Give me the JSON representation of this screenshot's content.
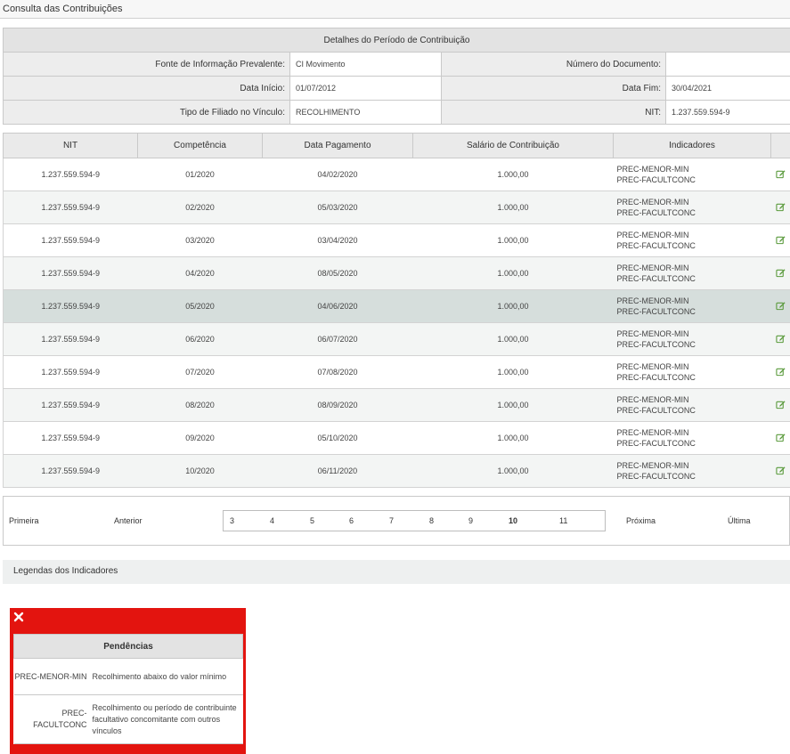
{
  "page": {
    "title": "Consulta das Contribuições"
  },
  "details": {
    "header": "Detalhes do Período de Contribuição",
    "fonte_label": "Fonte de Informação Prevalente:",
    "fonte_value": "CI Movimento",
    "numero_label": "Número do Documento:",
    "numero_value": "",
    "inicio_label": "Data Início:",
    "inicio_value": "01/07/2012",
    "fim_label": "Data Fim:",
    "fim_value": "30/04/2021",
    "tipo_label": "Tipo de Filiado no Vínculo:",
    "tipo_value": "RECOLHIMENTO",
    "nit_label": "NIT:",
    "nit_value": "1.237.559.594-9"
  },
  "contributions": {
    "columns": [
      "NIT",
      "Competência",
      "Data Pagamento",
      "Salário de Contribuição",
      "Indicadores",
      ""
    ],
    "rows": [
      {
        "nit": "1.237.559.594-9",
        "competencia": "01/2020",
        "data_pagamento": "04/02/2020",
        "salario": "1.000,00",
        "ind1": "PREC-MENOR-MIN",
        "ind2": "PREC-FACULTCONC"
      },
      {
        "nit": "1.237.559.594-9",
        "competencia": "02/2020",
        "data_pagamento": "05/03/2020",
        "salario": "1.000,00",
        "ind1": "PREC-MENOR-MIN",
        "ind2": "PREC-FACULTCONC"
      },
      {
        "nit": "1.237.559.594-9",
        "competencia": "03/2020",
        "data_pagamento": "03/04/2020",
        "salario": "1.000,00",
        "ind1": "PREC-MENOR-MIN",
        "ind2": "PREC-FACULTCONC"
      },
      {
        "nit": "1.237.559.594-9",
        "competencia": "04/2020",
        "data_pagamento": "08/05/2020",
        "salario": "1.000,00",
        "ind1": "PREC-MENOR-MIN",
        "ind2": "PREC-FACULTCONC"
      },
      {
        "nit": "1.237.559.594-9",
        "competencia": "05/2020",
        "data_pagamento": "04/06/2020",
        "salario": "1.000,00",
        "ind1": "PREC-MENOR-MIN",
        "ind2": "PREC-FACULTCONC"
      },
      {
        "nit": "1.237.559.594-9",
        "competencia": "06/2020",
        "data_pagamento": "06/07/2020",
        "salario": "1.000,00",
        "ind1": "PREC-MENOR-MIN",
        "ind2": "PREC-FACULTCONC"
      },
      {
        "nit": "1.237.559.594-9",
        "competencia": "07/2020",
        "data_pagamento": "07/08/2020",
        "salario": "1.000,00",
        "ind1": "PREC-MENOR-MIN",
        "ind2": "PREC-FACULTCONC"
      },
      {
        "nit": "1.237.559.594-9",
        "competencia": "08/2020",
        "data_pagamento": "08/09/2020",
        "salario": "1.000,00",
        "ind1": "PREC-MENOR-MIN",
        "ind2": "PREC-FACULTCONC"
      },
      {
        "nit": "1.237.559.594-9",
        "competencia": "09/2020",
        "data_pagamento": "05/10/2020",
        "salario": "1.000,00",
        "ind1": "PREC-MENOR-MIN",
        "ind2": "PREC-FACULTCONC"
      },
      {
        "nit": "1.237.559.594-9",
        "competencia": "10/2020",
        "data_pagamento": "06/11/2020",
        "salario": "1.000,00",
        "ind1": "PREC-MENOR-MIN",
        "ind2": "PREC-FACULTCONC"
      }
    ],
    "selected_row": 4,
    "edit_icon": "edit-icon",
    "edit_icon_color": "#5a9a3c"
  },
  "pagination": {
    "first": "Primeira",
    "previous": "Anterior",
    "pages": [
      "3",
      "4",
      "5",
      "6",
      "7",
      "8",
      "9",
      "10",
      "11"
    ],
    "current": "10",
    "next": "Próxima",
    "last": "Última"
  },
  "legend": {
    "title": "Legendas dos Indicadores",
    "panel_color": "#e3140f",
    "close_icon": "close-icon",
    "table_header": "Pendências",
    "items": [
      {
        "code": "PREC-MENOR-MIN",
        "description": "Recolhimento abaixo do valor mínimo"
      },
      {
        "code": "PREC-FACULTCONC",
        "description": "Recolhimento ou período de contribuinte facultativo concomitante com outros vínculos"
      }
    ]
  }
}
